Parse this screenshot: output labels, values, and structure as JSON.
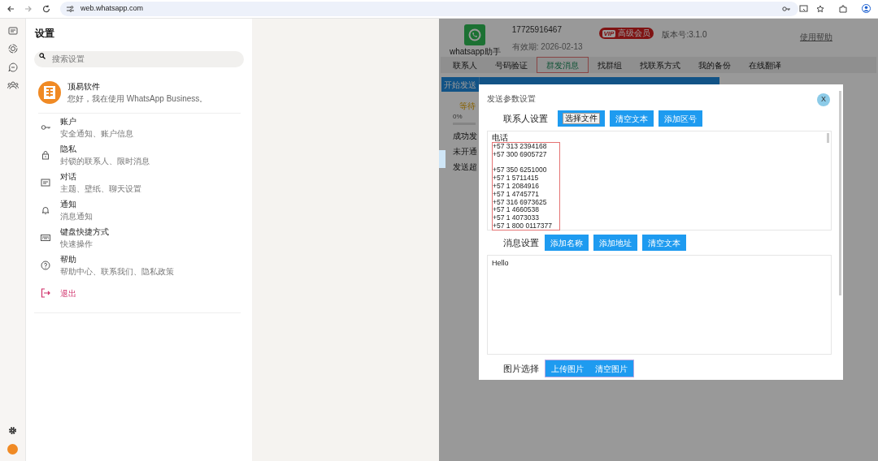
{
  "browser": {
    "url": "web.whatsapp.com"
  },
  "settings": {
    "title": "设置",
    "search_placeholder": "搜索设置",
    "profile": {
      "name": "顶易软件",
      "about": "您好，我在使用 WhatsApp Business。"
    },
    "items": [
      {
        "kind": "key",
        "title": "账户",
        "subtitle": "安全通知、账户信息"
      },
      {
        "kind": "lock",
        "title": "隐私",
        "subtitle": "封锁的联系人、限时消息"
      },
      {
        "kind": "chat",
        "title": "对话",
        "subtitle": "主题、壁纸、聊天设置"
      },
      {
        "kind": "bell",
        "title": "通知",
        "subtitle": "消息通知"
      },
      {
        "kind": "keyboard",
        "title": "键盘快捷方式",
        "subtitle": "快速操作"
      },
      {
        "kind": "help",
        "title": "帮助",
        "subtitle": "帮助中心、联系我们、隐私政策"
      },
      {
        "kind": "logout",
        "title": "退出"
      }
    ]
  },
  "helper": {
    "app_name": "whatsapp助手",
    "phone": "17725916467",
    "expiry": "有效期: 2026-02-13",
    "vip": "VIP",
    "vip_level": "高级会员",
    "version": "版本号:3.1.0",
    "help_link": "使用帮助",
    "tabs": [
      {
        "label": "联系人",
        "selected": false
      },
      {
        "label": "号码验证",
        "selected": false
      },
      {
        "label": "群发消息",
        "selected": true
      },
      {
        "label": "找群组",
        "selected": false
      },
      {
        "label": "找联系方式",
        "selected": false
      },
      {
        "label": "我的备份",
        "selected": false
      },
      {
        "label": "在线翻译",
        "selected": false
      }
    ],
    "toolbar": [
      "开始发送"
    ],
    "status": {
      "waiting": "等待",
      "progress": "0%",
      "lines": [
        "成功发",
        "未开通",
        "发送超"
      ]
    }
  },
  "dialog": {
    "title": "发送参数设置",
    "close": "X",
    "contacts": {
      "label": "联系人设置",
      "file_button": "选择文件",
      "buttons": [
        "清空文本",
        "添加区号"
      ],
      "header": "电话",
      "phones": [
        {
          "number": "+57 313 2394168",
          "gap_before": false
        },
        {
          "number": "+57 300 6905727",
          "gap_before": false
        },
        {
          "number": "+57 350 6251000",
          "gap_before": true
        },
        {
          "number": "+57 1 5711415",
          "gap_before": false
        },
        {
          "number": "+57 1 2084916",
          "gap_before": false
        },
        {
          "number": "+57 1 4745771",
          "gap_before": false
        },
        {
          "number": "+57 316 6973625",
          "gap_before": false
        },
        {
          "number": "+57 1 4660538",
          "gap_before": false
        },
        {
          "number": "+57 1 4073033",
          "gap_before": false
        },
        {
          "number": "+57 1 800 0117377",
          "gap_before": false
        }
      ]
    },
    "message": {
      "label": "消息设置",
      "buttons": [
        "添加名称",
        "添加地址",
        "清空文本"
      ],
      "text": "Hello"
    },
    "images": {
      "label": "图片选择",
      "buttons": [
        "上传图片",
        "清空图片"
      ]
    }
  }
}
